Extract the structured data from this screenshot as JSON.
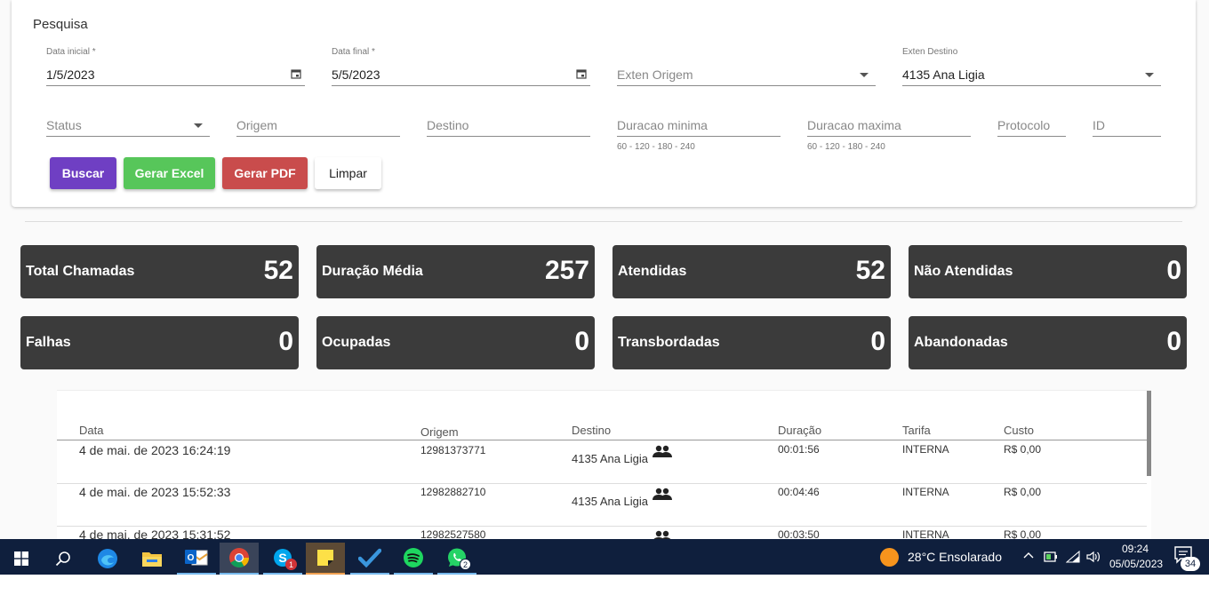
{
  "search": {
    "title": "Pesquisa",
    "data_inicial": {
      "label": "Data inicial *",
      "value": "1/5/2023"
    },
    "data_final": {
      "label": "Data final *",
      "value": "5/5/2023"
    },
    "exten_origem": {
      "placeholder": "Exten Origem"
    },
    "exten_destino": {
      "label": "Exten Destino",
      "value": "4135 Ana Ligia"
    },
    "status": {
      "placeholder": "Status"
    },
    "origem": {
      "placeholder": "Origem"
    },
    "destino": {
      "placeholder": "Destino"
    },
    "duracao_minima": {
      "placeholder": "Duracao minima",
      "hint": "60 - 120 - 180 - 240"
    },
    "duracao_maxima": {
      "placeholder": "Duracao maxima",
      "hint": "60 - 120 - 180 - 240"
    },
    "protocolo": {
      "placeholder": "Protocolo"
    },
    "id": {
      "placeholder": "ID"
    },
    "buttons": {
      "buscar": "Buscar",
      "gerar_excel": "Gerar Excel",
      "gerar_pdf": "Gerar PDF",
      "limpar": "Limpar"
    }
  },
  "colors": {
    "buscar": "#6f3fc3",
    "excel": "#57c65a",
    "pdf": "#c94c4c",
    "stat_bg": "#3b3b3b",
    "taskbar": "#0f1f3d"
  },
  "stats": [
    {
      "label": "Total Chamadas",
      "value": "52"
    },
    {
      "label": "Duração Média",
      "value": "257"
    },
    {
      "label": "Atendidas",
      "value": "52"
    },
    {
      "label": "Não Atendidas",
      "value": "0"
    },
    {
      "label": "Falhas",
      "value": "0"
    },
    {
      "label": "Ocupadas",
      "value": "0"
    },
    {
      "label": "Transbordadas",
      "value": "0"
    },
    {
      "label": "Abandonadas",
      "value": "0"
    }
  ],
  "table": {
    "headers": {
      "data": "Data",
      "origem": "Origem",
      "destino": "Destino",
      "duracao": "Duração",
      "tarifa": "Tarifa",
      "custo": "Custo"
    },
    "rows": [
      {
        "data": "4 de mai. de 2023 16:24:19",
        "origem": "12981373771",
        "destino": "4135 Ana Ligia",
        "duracao": "00:01:56",
        "tarifa": "INTERNA",
        "custo": "R$ 0,00",
        "destino_icon": "group-icon"
      },
      {
        "data": "4 de mai. de 2023 15:52:33",
        "origem": "12982882710",
        "destino": "4135 Ana Ligia",
        "duracao": "00:04:46",
        "tarifa": "INTERNA",
        "custo": "R$ 0,00",
        "destino_icon": "group-icon"
      },
      {
        "data": "4 de mai. de 2023 15:31:52",
        "origem": "12982527580",
        "destino": "",
        "duracao": "00:03:50",
        "tarifa": "INTERNA",
        "custo": "R$ 0,00",
        "destino_icon": "group-icon"
      }
    ]
  },
  "taskbar": {
    "apps": [
      "windows-start",
      "search",
      "edge",
      "file-explorer",
      "outlook",
      "chrome",
      "skype",
      "sticky-notes",
      "todo",
      "spotify",
      "whatsapp"
    ],
    "skype_badge": "1",
    "whatsapp_badge": "2",
    "weather": "28°C  Ensolarado",
    "time": "09:24",
    "date": "05/05/2023",
    "notifications": "34"
  }
}
